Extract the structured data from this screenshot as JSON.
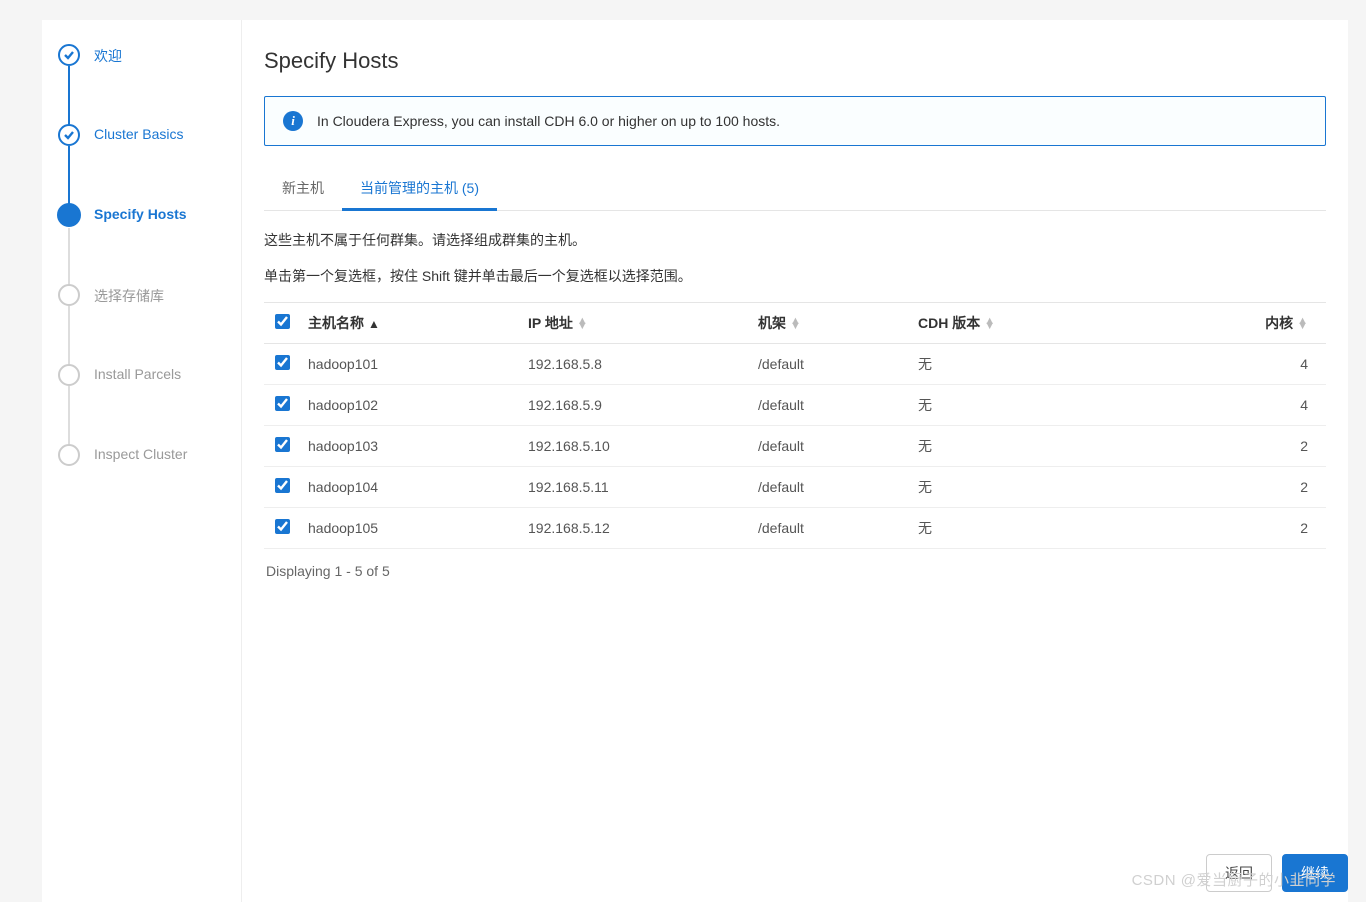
{
  "sidebar": {
    "steps": [
      {
        "label": "欢迎"
      },
      {
        "label": "Cluster Basics"
      },
      {
        "label": "Specify Hosts"
      },
      {
        "label": "选择存储库"
      },
      {
        "label": "Install Parcels"
      },
      {
        "label": "Inspect Cluster"
      }
    ]
  },
  "main": {
    "title": "Specify Hosts",
    "banner": "In Cloudera Express, you can install CDH 6.0 or higher on up to 100 hosts.",
    "tabs": {
      "new_host": "新主机",
      "managed": "当前管理的主机 (5)"
    },
    "desc1": "这些主机不属于任何群集。请选择组成群集的主机。",
    "desc2": "单击第一个复选框，按住 Shift 键并单击最后一个复选框以选择范围。",
    "columns": {
      "hostname": "主机名称",
      "ip": "IP 地址",
      "rack": "机架",
      "cdh": "CDH 版本",
      "cores": "内核"
    },
    "rows": [
      {
        "host": "hadoop101",
        "ip": "192.168.5.8",
        "rack": "/default",
        "cdh": "无",
        "cores": "4"
      },
      {
        "host": "hadoop102",
        "ip": "192.168.5.9",
        "rack": "/default",
        "cdh": "无",
        "cores": "4"
      },
      {
        "host": "hadoop103",
        "ip": "192.168.5.10",
        "rack": "/default",
        "cdh": "无",
        "cores": "2"
      },
      {
        "host": "hadoop104",
        "ip": "192.168.5.11",
        "rack": "/default",
        "cdh": "无",
        "cores": "2"
      },
      {
        "host": "hadoop105",
        "ip": "192.168.5.12",
        "rack": "/default",
        "cdh": "无",
        "cores": "2"
      }
    ],
    "pager": "Displaying 1 - 5 of 5",
    "buttons": {
      "back": "返回",
      "continue": "继续"
    }
  },
  "watermark": "CSDN @爱当厨子的小韭同学"
}
